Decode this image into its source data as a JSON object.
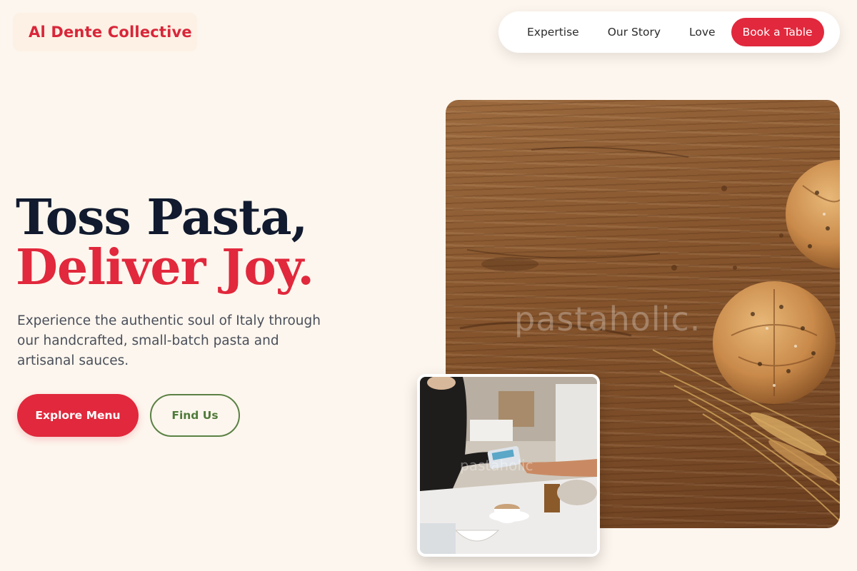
{
  "brand": {
    "name": "Al Dente Collective"
  },
  "nav": {
    "links": [
      "Expertise",
      "Our Story",
      "Love"
    ],
    "cta": "Book a Table"
  },
  "hero": {
    "headline_line1": "Toss Pasta,",
    "headline_line2": "Deliver Joy.",
    "subtitle": "Experience the authentic soul of Italy through our handcrafted, small-batch pasta and artisanal sauces.",
    "primary_button": "Explore Menu",
    "secondary_button": "Find Us"
  },
  "images": {
    "main_watermark": "pastaholic.",
    "inset_watermark": "pastaholic"
  },
  "colors": {
    "accent": "#e1283c",
    "heading": "#111a2e",
    "secondary": "#5b8144",
    "background": "#fdf6ee"
  }
}
